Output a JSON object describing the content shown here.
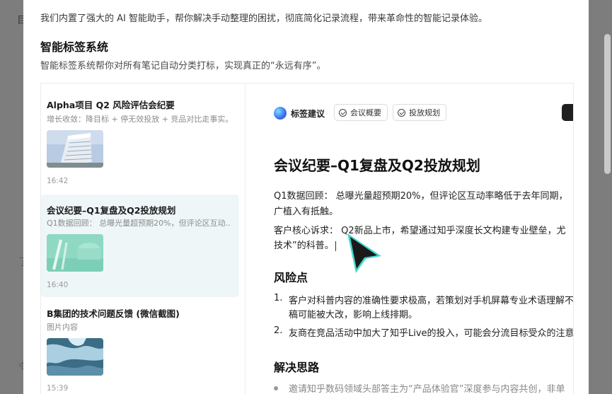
{
  "background": {
    "left_glyph_top": "目",
    "left_glyph_mid": "了",
    "left_glyph_bottom": "令"
  },
  "modal": {
    "intro": "我们内置了强大的 AI 智能助手，帮你解决手动整理的困扰，彻底简化记录流程，带来革命性的智能记录体验。",
    "section_title": "智能标签系统",
    "section_desc": "智能标签系统帮你对所有笔记自动分类打标，实现真正的“永远有序”。"
  },
  "notes": [
    {
      "title": "Alpha项目 Q2 风险评估会纪要",
      "snippet": "增长收敛：降目标 + 停无效投放 + 竞品对比走事实。",
      "time": "16:42",
      "thumb": "building"
    },
    {
      "title": "会议纪要–Q1复盘及Q2投放规划",
      "snippet": "Q1数据回顾： 总曝光量超预期20%，但评论区互动...",
      "time": "16:40",
      "thumb": "pencils"
    },
    {
      "title": "B集团的技术问题反馈 (微信截图)",
      "snippet": "图片内容",
      "time": "15:39",
      "thumb": "ice"
    }
  ],
  "detail": {
    "tag_label": "标签建议",
    "chips": [
      "会议概要",
      "投放规划"
    ],
    "title": "会议纪要–Q1复盘及Q2投放规划",
    "p1_line1": "Q1数据回顾： 总曝光量超预期20%，但评论区互动率略低于去年同期，",
    "p1_line2": "广植入有抵触。",
    "p2_line1": "客户核心诉求： Q2新品上市，希望通过知乎深度长文构建专业壁垒，尤",
    "p2_line2": "技术”的科普。",
    "risk_heading": "风险点",
    "risks": [
      {
        "num": "1.",
        "line1": "客户对科普内容的准确性要求极高，若策划对手机屏幕专业术语理解不",
        "line2": "稿可能被大改，影响上线排期。"
      },
      {
        "num": "2.",
        "line1": "友商在竞品活动中加大了知乎Live的投入，可能会分流目标受众的注意"
      }
    ],
    "solution_heading": "解决思路",
    "solution_first": "邀请知乎数码领域头部答主为“产品体验官”深度参与内容共创，非单"
  },
  "colors": {
    "active_note_bg": "#eef6f8",
    "overlay": "#7d7d7d",
    "pointer": "#1a1a1a",
    "pointer_glow": "#2fd0c4"
  }
}
